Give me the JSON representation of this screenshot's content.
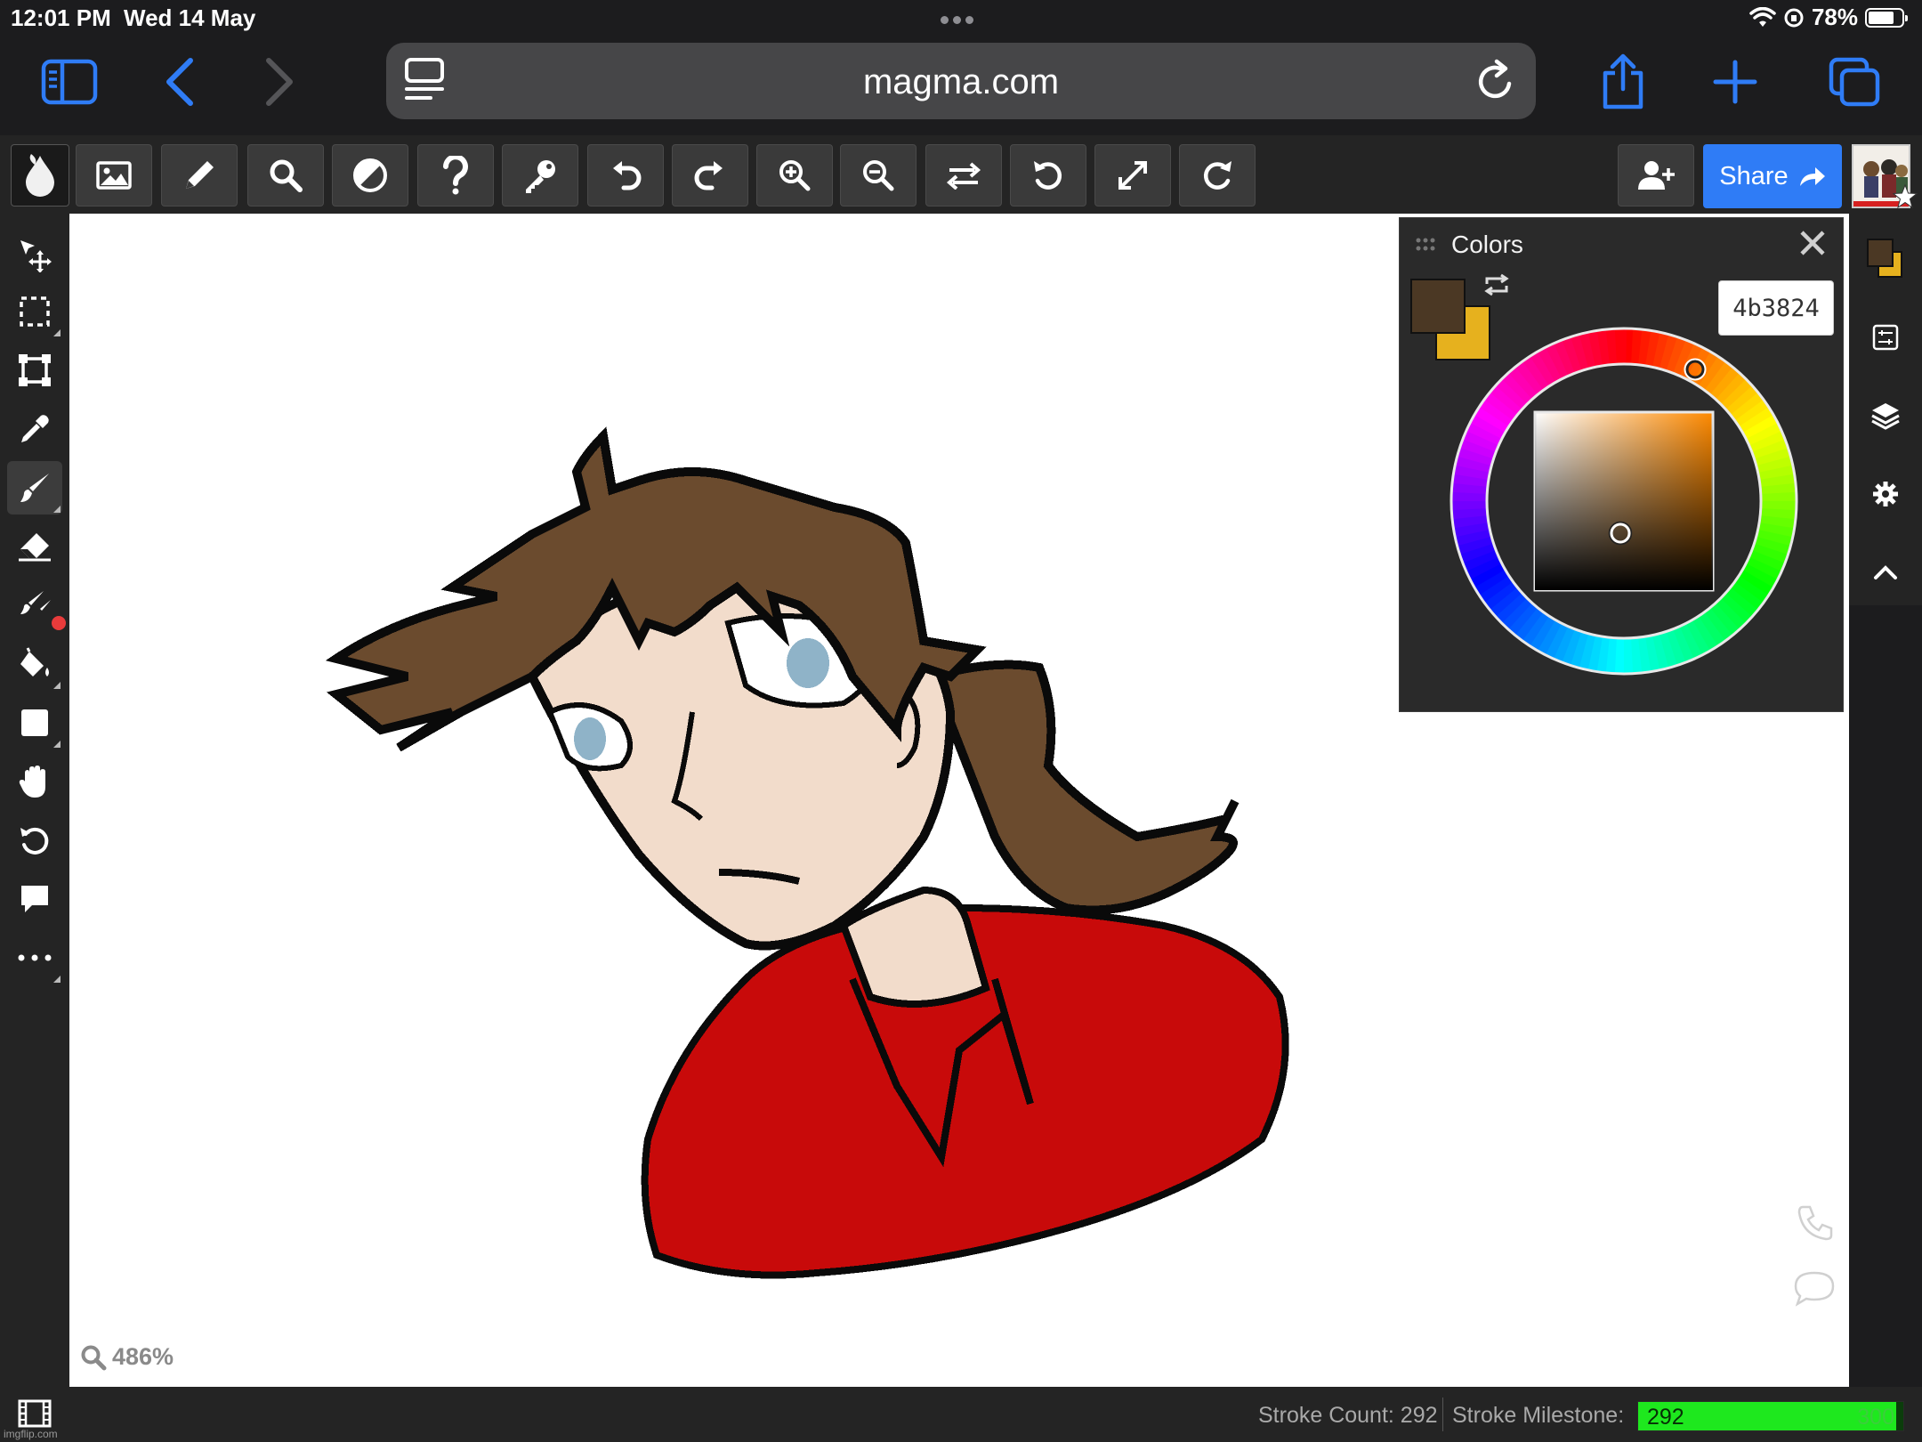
{
  "status_bar": {
    "time": "12:01 PM",
    "date": "Wed 14 May",
    "battery": "78%",
    "battery_level": 0.78
  },
  "browser": {
    "url": "magma.com"
  },
  "toolbar": {
    "tools": [
      "color-drop",
      "image",
      "pencil",
      "search",
      "contrast",
      "help",
      "key",
      "undo",
      "redo",
      "zoom-in",
      "zoom-out",
      "flip",
      "rotate-left",
      "fullscreen",
      "rotate-right"
    ],
    "share_label": "Share"
  },
  "colors_panel": {
    "title": "Colors",
    "hex_value": "4b3824",
    "primary_color": "#4b3824",
    "secondary_color": "#e6b11e"
  },
  "canvas": {
    "zoom_label": "486%"
  },
  "footer": {
    "stroke_count_label": "Stroke Count: 292",
    "milestone_label": "Stroke Milestone:",
    "milestone_value": "292",
    "milestone_target": "300",
    "milestone_progress": 0.973
  },
  "watermark": "imgflip.com"
}
